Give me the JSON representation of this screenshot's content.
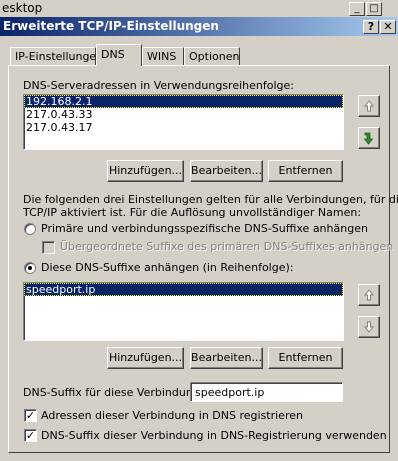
{
  "background_window": {
    "title": "esktop",
    "minimize_glyph": "_",
    "maximize_glyph": "□"
  },
  "dialog": {
    "title": "Erweiterte TCP/IP-Einstellungen",
    "help_glyph": "?",
    "close_glyph": "✕"
  },
  "tabs": [
    {
      "label": "IP-Einstellungen",
      "active": false
    },
    {
      "label": "DNS",
      "active": true
    },
    {
      "label": "WINS",
      "active": false
    },
    {
      "label": "Optionen",
      "active": false
    }
  ],
  "dns_servers": {
    "label": "DNS-Serveradressen in Verwendungsreihenfolge:",
    "items": [
      "192.168.2.1",
      "217.0.43.33",
      "217.0.43.17"
    ],
    "selected_index": 0,
    "move_up_icon": "arrow-up-icon",
    "move_down_icon": "arrow-down-icon"
  },
  "server_buttons": {
    "add": "Hinzufügen...",
    "edit": "Bearbeiten...",
    "remove": "Entfernen"
  },
  "info_text": {
    "line1": "Die folgenden drei Einstellungen gelten für alle Verbindungen, für die",
    "line2": "TCP/IP aktiviert ist. Für die Auflösung unvollständiger Namen:"
  },
  "options": {
    "radio_primary": "Primäre und verbindungsspezifische DNS-Suffixe anhängen",
    "check_parent": "Übergeordnete Suffixe des primären DNS-Suffixes anhängen",
    "radio_these": "Diese DNS-Suffixe anhängen (in Reihenfolge):",
    "selected_radio": "these"
  },
  "suffixes": {
    "items": [
      "speedport.ip"
    ],
    "selected_index": 0
  },
  "suffix_buttons": {
    "add": "Hinzufügen...",
    "edit": "Bearbeiten...",
    "remove": "Entfernen"
  },
  "connection_suffix": {
    "label": "DNS-Suffix für diese Verbindung:",
    "value": "speedport.ip"
  },
  "checkboxes": {
    "register": {
      "label": "Adressen dieser Verbindung in DNS registrieren",
      "checked": true
    },
    "use_suffix": {
      "label": "DNS-Suffix dieser Verbindung in DNS-Registrierung verwenden",
      "checked": true
    }
  },
  "colors": {
    "face": "#d4d0c8",
    "title_start": "#0a246a",
    "title_end": "#a6caf0",
    "selection": "#0a246a",
    "arrow_green": "#2e8b2e",
    "disabled": "#808080"
  }
}
